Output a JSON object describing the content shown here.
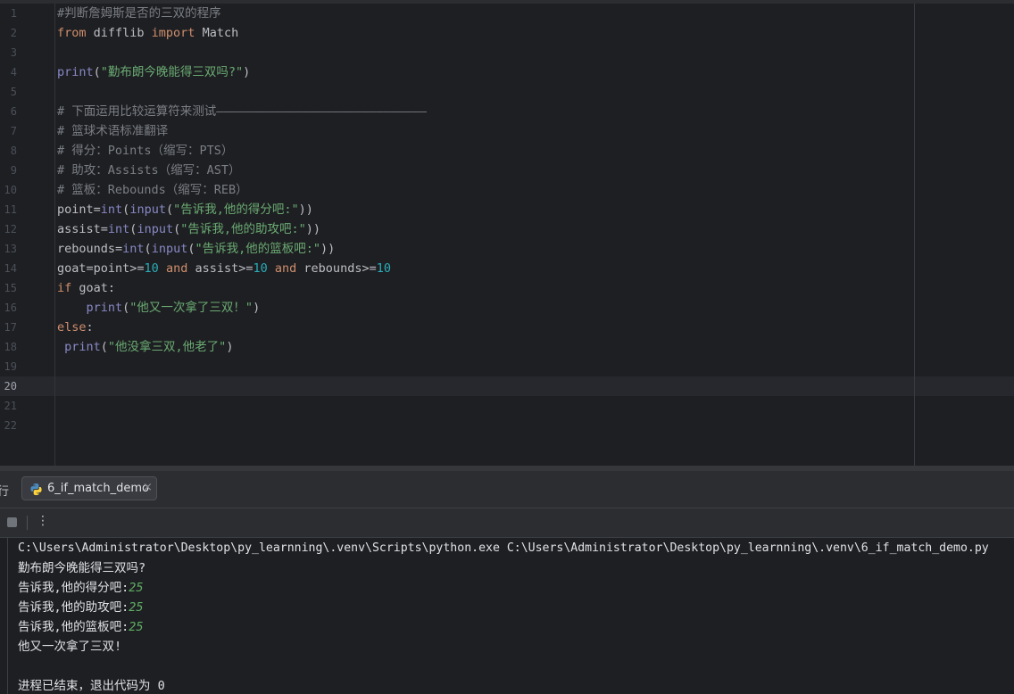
{
  "editor": {
    "active_line": 20,
    "line_numbers": [
      "1",
      "2",
      "3",
      "4",
      "5",
      "6",
      "7",
      "8",
      "9",
      "10",
      "11",
      "12",
      "13",
      "14",
      "15",
      "16",
      "17",
      "18",
      "19",
      "20",
      "21",
      "22"
    ],
    "lines": [
      [
        {
          "t": "#判断詹姆斯是否的三双的程序",
          "c": "cm"
        }
      ],
      [
        {
          "t": "from",
          "c": "kw"
        },
        {
          "t": " difflib ",
          "c": "pl"
        },
        {
          "t": "import",
          "c": "kw"
        },
        {
          "t": " Match",
          "c": "pl"
        }
      ],
      [],
      [
        {
          "t": "print",
          "c": "fn"
        },
        {
          "t": "(",
          "c": "pl"
        },
        {
          "t": "\"勤布朗今晚能得三双吗?\"",
          "c": "str"
        },
        {
          "t": ")",
          "c": "pl"
        }
      ],
      [],
      [
        {
          "t": "# 下面运用比较运算符来测试—————————————————————————————",
          "c": "cm"
        }
      ],
      [
        {
          "t": "# 篮球术语标准翻译",
          "c": "cm"
        }
      ],
      [
        {
          "t": "# 得分：Points（缩写：PTS）",
          "c": "cm"
        }
      ],
      [
        {
          "t": "# 助攻：Assists（缩写：AST）",
          "c": "cm"
        }
      ],
      [
        {
          "t": "# 篮板：Rebounds（缩写：REB）",
          "c": "cm"
        }
      ],
      [
        {
          "t": "point=",
          "c": "pl"
        },
        {
          "t": "int",
          "c": "fn"
        },
        {
          "t": "(",
          "c": "pl"
        },
        {
          "t": "input",
          "c": "fn"
        },
        {
          "t": "(",
          "c": "pl"
        },
        {
          "t": "\"告诉我,他的得分吧:\"",
          "c": "str"
        },
        {
          "t": "))",
          "c": "pl"
        }
      ],
      [
        {
          "t": "assist=",
          "c": "pl"
        },
        {
          "t": "int",
          "c": "fn"
        },
        {
          "t": "(",
          "c": "pl"
        },
        {
          "t": "input",
          "c": "fn"
        },
        {
          "t": "(",
          "c": "pl"
        },
        {
          "t": "\"告诉我,他的助攻吧:\"",
          "c": "str"
        },
        {
          "t": "))",
          "c": "pl"
        }
      ],
      [
        {
          "t": "rebounds=",
          "c": "pl"
        },
        {
          "t": "int",
          "c": "fn"
        },
        {
          "t": "(",
          "c": "pl"
        },
        {
          "t": "input",
          "c": "fn"
        },
        {
          "t": "(",
          "c": "pl"
        },
        {
          "t": "\"告诉我,他的篮板吧:\"",
          "c": "str"
        },
        {
          "t": "))",
          "c": "pl"
        }
      ],
      [
        {
          "t": "goat=point>=",
          "c": "pl"
        },
        {
          "t": "10",
          "c": "num"
        },
        {
          "t": " ",
          "c": "pl"
        },
        {
          "t": "and",
          "c": "kw"
        },
        {
          "t": " assist>=",
          "c": "pl"
        },
        {
          "t": "10",
          "c": "num"
        },
        {
          "t": " ",
          "c": "pl"
        },
        {
          "t": "and",
          "c": "kw"
        },
        {
          "t": " rebounds>=",
          "c": "pl"
        },
        {
          "t": "10",
          "c": "num"
        }
      ],
      [
        {
          "t": "if",
          "c": "kw"
        },
        {
          "t": " goat:",
          "c": "pl"
        }
      ],
      [
        {
          "t": "    ",
          "c": "pl"
        },
        {
          "t": "print",
          "c": "fn"
        },
        {
          "t": "(",
          "c": "pl"
        },
        {
          "t": "\"他又一次拿了三双！\"",
          "c": "str"
        },
        {
          "t": ")",
          "c": "pl"
        }
      ],
      [
        {
          "t": "else",
          "c": "kw"
        },
        {
          "t": ":",
          "c": "pl"
        }
      ],
      [
        {
          "t": " ",
          "c": "pl"
        },
        {
          "t": "print",
          "c": "fn"
        },
        {
          "t": "(",
          "c": "pl"
        },
        {
          "t": "\"他没拿三双,他老了\"",
          "c": "str"
        },
        {
          "t": ")",
          "c": "pl"
        }
      ],
      [],
      [],
      [],
      []
    ]
  },
  "run_panel": {
    "left_label": "行",
    "tab": {
      "label": "6_if_match_demo",
      "close": "×"
    },
    "more": "⋮"
  },
  "console": {
    "command": "C:\\Users\\Administrator\\Desktop\\py_learnning\\.venv\\Scripts\\python.exe C:\\Users\\Administrator\\Desktop\\py_learnning\\.venv\\6_if_match_demo.py",
    "lines": [
      {
        "text": "勤布朗今晚能得三双吗?"
      },
      {
        "text": "告诉我,他的得分吧:",
        "input": "25"
      },
      {
        "text": "告诉我,他的助攻吧:",
        "input": "25"
      },
      {
        "text": "告诉我,他的篮板吧:",
        "input": "25"
      },
      {
        "text": "他又一次拿了三双!"
      },
      {
        "text": ""
      },
      {
        "text": "进程已结束，退出代码为 0"
      }
    ]
  },
  "colors": {
    "editor_bg": "#1e1f22",
    "keyword": "#cf8e6d",
    "builtin": "#8888c6",
    "string": "#6aab73",
    "number": "#2aacb8",
    "comment": "#7a7e85",
    "text": "#bcbec4",
    "console_input": "#5fad65"
  }
}
